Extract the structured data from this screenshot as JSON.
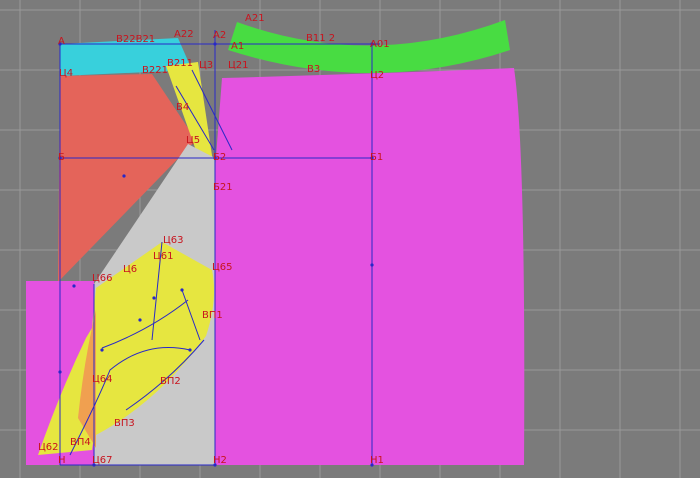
{
  "colors": {
    "background": "#7b7b7b",
    "grid": "#9a9a9a",
    "cyan_piece": "#38d0dc",
    "green_piece": "#48dc42",
    "red_piece": "#e4645a",
    "yellow_piece": "#e6e640",
    "gray_piece": "#c9c9c9",
    "magenta_piece": "#e452e0",
    "construction_line": "#2828c8",
    "label": "#c8141e"
  },
  "labels": {
    "A": "А",
    "B22B21": "В22В21",
    "A22": "А22",
    "A2": "А2",
    "A21": "А21",
    "A1": "А1",
    "B11_2": "В11 2",
    "A01": "А01",
    "B221": "В221",
    "B211": "В211",
    "U3": "Ц3",
    "U21": "Ц21",
    "B3": "В3",
    "U2": "Ц2",
    "U4": "Ц4",
    "B4": "В4",
    "U5": "Ц5",
    "B": "Б",
    "B2": "Б2",
    "B1": "Б1",
    "B21": "Б21",
    "U63": "Ц63",
    "U61": "Ц61",
    "U6": "Ц6",
    "U65": "Ц65",
    "U66": "Ц66",
    "VP1": "ВП1",
    "VP2": "ВП2",
    "U64": "Ц64",
    "VP3": "ВП3",
    "VP4": "ВП4",
    "U62": "Ц62",
    "N": "Н",
    "U67": "Ц67",
    "N2": "Н2",
    "N1": "Н1"
  }
}
